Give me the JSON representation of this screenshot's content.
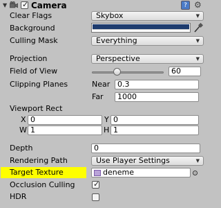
{
  "header": {
    "title": "Camera",
    "enabled": true
  },
  "properties": {
    "clear_flags": {
      "label": "Clear Flags",
      "value": "Skybox"
    },
    "background": {
      "label": "Background",
      "color": "#1e3c6e"
    },
    "culling_mask": {
      "label": "Culling Mask",
      "value": "Everything"
    },
    "projection": {
      "label": "Projection",
      "value": "Perspective"
    },
    "field_of_view": {
      "label": "Field of View",
      "value": "60",
      "fraction": 0.33
    },
    "clipping_planes": {
      "label": "Clipping Planes",
      "near_label": "Near",
      "near_value": "0.3",
      "far_label": "Far",
      "far_value": "1000"
    },
    "viewport_rect": {
      "label": "Viewport Rect",
      "x_label": "X",
      "x_value": "0",
      "y_label": "Y",
      "y_value": "0",
      "w_label": "W",
      "w_value": "1",
      "h_label": "H",
      "h_value": "1"
    },
    "depth": {
      "label": "Depth",
      "value": "0"
    },
    "rendering_path": {
      "label": "Rendering Path",
      "value": "Use Player Settings"
    },
    "target_texture": {
      "label": "Target Texture",
      "value": "deneme",
      "highlight_color": "#ffff00"
    },
    "occlusion_culling": {
      "label": "Occlusion Culling",
      "checked": true
    },
    "hdr": {
      "label": "HDR",
      "checked": false
    }
  },
  "icons": {
    "help": "help-icon",
    "settings": "gear-icon",
    "picker": "eyedropper-icon",
    "object_picker": "object-picker-icon"
  }
}
